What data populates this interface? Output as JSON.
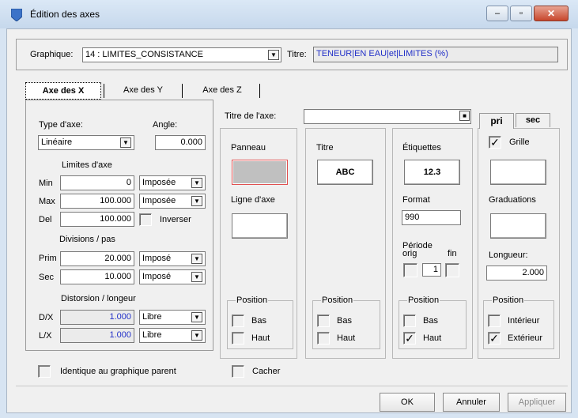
{
  "window": {
    "title": "Édition des axes"
  },
  "chart_select": {
    "label": "Graphique:",
    "value": "14 : LIMITES_CONSISTANCE",
    "title_label": "Titre:",
    "title_value": "TENEUR|EN EAU|et|LIMITES (%)"
  },
  "tabs": [
    "Axe des X",
    "Axe des Y",
    "Axe des Z"
  ],
  "axis": {
    "type_label": "Type d'axe:",
    "type_value": "Linéaire",
    "angle_label": "Angle:",
    "angle_value": "0.000",
    "limits_label": "Limites d'axe",
    "min_label": "Min",
    "min_value": "0",
    "min_mode": "Imposée",
    "max_label": "Max",
    "max_value": "100.000",
    "max_mode": "Imposée",
    "del_label": "Del",
    "del_value": "100.000",
    "invert_label": "Inverser",
    "divisions_label": "Divisions / pas",
    "prim_label": "Prim",
    "prim_value": "20.000",
    "prim_mode": "Imposé",
    "sec_label": "Sec",
    "sec_value": "10.000",
    "sec_mode": "Imposé",
    "distortion_label": "Distorsion / longeur",
    "dx_label": "D/X",
    "dx_value": "1.000",
    "dx_mode": "Libre",
    "lx_label": "L/X",
    "lx_value": "1.000",
    "lx_mode": "Libre"
  },
  "axis_title": {
    "label": "Titre de l'axe:",
    "value": "",
    "menu_icon": "■"
  },
  "panel": {
    "panneau_label": "Panneau",
    "axis_line_label": "Ligne d'axe",
    "position_label": "Position",
    "bas_label": "Bas",
    "haut_label": "Haut"
  },
  "title_col": {
    "label": "Titre",
    "font_sample": "ABC",
    "position_label": "Position",
    "bas_label": "Bas",
    "haut_label": "Haut"
  },
  "labels_col": {
    "label": "Étiquettes",
    "font_sample": "12.3",
    "format_label": "Format",
    "format_value": "990",
    "period_label": "Période",
    "orig_label": "orig",
    "fin_label": "fin",
    "period_value": "1",
    "position_label": "Position",
    "bas_label": "Bas",
    "haut_label": "Haut",
    "haut_checked": true
  },
  "grid_col": {
    "tab_pri": "pri",
    "tab_sec": "sec",
    "grid_label": "Grille",
    "grid_checked": true,
    "graduations_label": "Graduations",
    "length_label": "Longueur:",
    "length_value": "2.000",
    "position_label": "Position",
    "interior_label": "Intérieur",
    "exterior_label": "Extérieur",
    "exterior_checked": true
  },
  "footer": {
    "identical_label": "Identique au graphique parent",
    "hide_label": "Cacher",
    "ok_label": "OK",
    "cancel_label": "Annuler",
    "apply_label": "Appliquer"
  },
  "icons": {
    "checkmark": "✓",
    "minimize": "‒",
    "maximize": "▫",
    "close": "✕",
    "dropdown": "▼"
  },
  "colors": {
    "readonly_text": "#2230c8",
    "panel_swatch": "#c0c0c0",
    "panel_swatch_border": "#e05050",
    "title_text": "#2230c8"
  }
}
